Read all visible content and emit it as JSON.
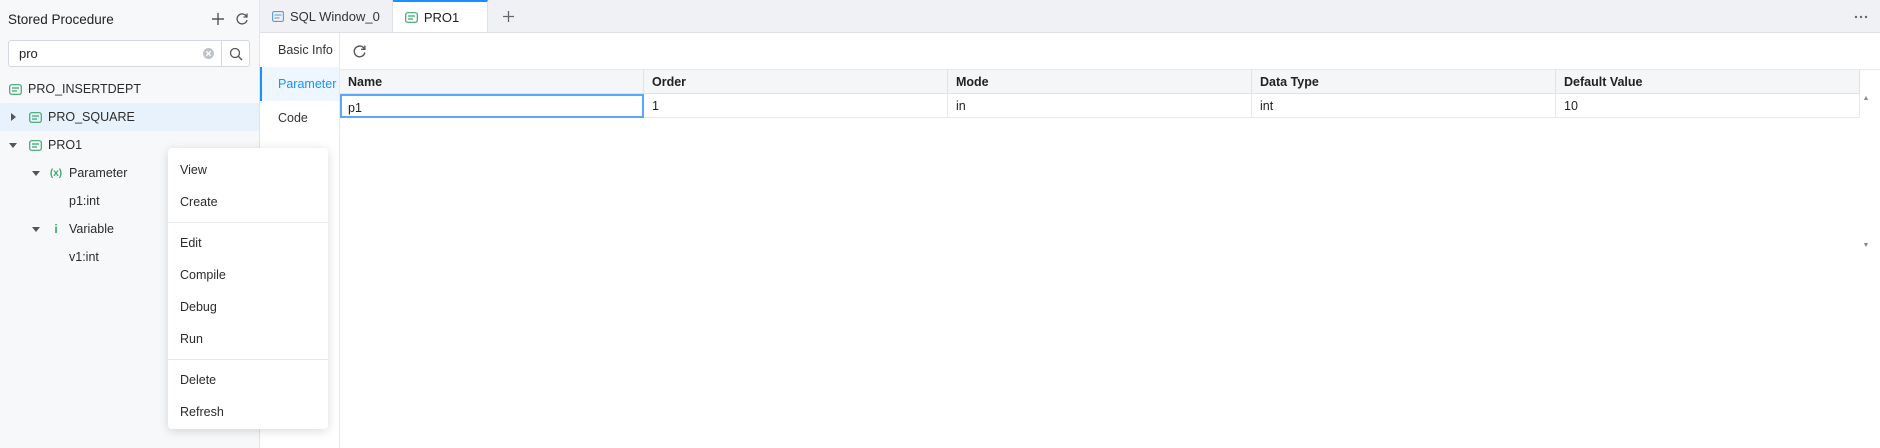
{
  "sidebar": {
    "title": "Stored Procedure",
    "search": {
      "value": "pro",
      "placeholder": ""
    },
    "tree": [
      {
        "label": "PRO_INSERTDEPT",
        "type": "procedure",
        "level": 0,
        "expandable": false
      },
      {
        "label": "PRO_SQUARE",
        "type": "procedure",
        "level": 0,
        "expandable": true,
        "expanded": false,
        "selected": true
      },
      {
        "label": "PRO1",
        "type": "procedure",
        "level": 0,
        "expandable": true,
        "expanded": true
      },
      {
        "label": "Parameter",
        "type": "param-group",
        "level": 1,
        "expandable": true,
        "expanded": true
      },
      {
        "label": "p1:int",
        "type": "leaf",
        "level": 2
      },
      {
        "label": "Variable",
        "type": "var-group",
        "level": 1,
        "expandable": true,
        "expanded": true
      },
      {
        "label": "v1:int",
        "type": "leaf",
        "level": 2
      }
    ]
  },
  "context_menu": {
    "groups": [
      [
        "View",
        "Create"
      ],
      [
        "Edit",
        "Compile",
        "Debug",
        "Run"
      ],
      [
        "Delete",
        "Refresh"
      ]
    ]
  },
  "tabs": [
    {
      "label": "SQL Window_0",
      "active": false,
      "icon": "sql-window-icon"
    },
    {
      "label": "PRO1",
      "active": true,
      "icon": "procedure-icon"
    }
  ],
  "subnav": {
    "items": [
      {
        "label": "Basic Info",
        "active": false
      },
      {
        "label": "Parameter",
        "active": true
      },
      {
        "label": "Code",
        "active": false
      }
    ]
  },
  "grid": {
    "columns": [
      "Name",
      "Order",
      "Mode",
      "Data Type",
      "Default Value"
    ],
    "rows": [
      [
        "p1",
        "1",
        "in",
        "int",
        "10"
      ]
    ]
  },
  "colors": {
    "accent": "#1890ff",
    "icon_green": "#3aa76d",
    "selected_row": "#e8f2fd"
  }
}
